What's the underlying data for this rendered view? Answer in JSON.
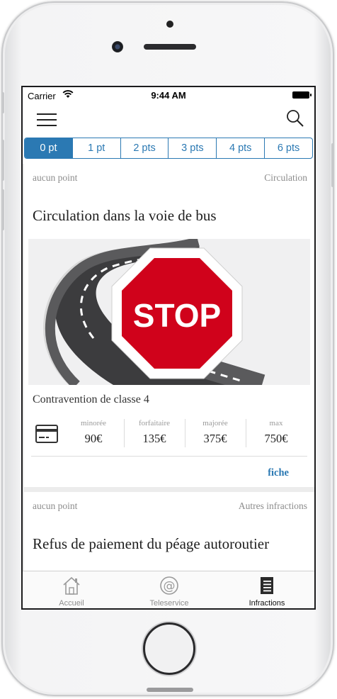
{
  "status_bar": {
    "carrier": "Carrier",
    "time": "9:44 AM"
  },
  "navbar": {
    "menu_icon": "hamburger-menu-icon",
    "search_icon": "search-icon"
  },
  "segments": [
    {
      "label": "0 pt",
      "selected": true
    },
    {
      "label": "1 pt",
      "selected": false
    },
    {
      "label": "2 pts",
      "selected": false
    },
    {
      "label": "3 pts",
      "selected": false
    },
    {
      "label": "4 pts",
      "selected": false
    },
    {
      "label": "6 pts",
      "selected": false
    }
  ],
  "cards": [
    {
      "points": "aucun point",
      "category": "Circulation",
      "title": "Circulation dans la voie de bus",
      "image": {
        "sign_text": "STOP",
        "icon": "stop-sign-road-illustration"
      },
      "classe": "Contravention de classe 4",
      "payment_icon": "credit-card-icon",
      "prices": [
        {
          "label": "minorée",
          "value": "90€"
        },
        {
          "label": "forfaitaire",
          "value": "135€"
        },
        {
          "label": "majorée",
          "value": "375€"
        },
        {
          "label": "max",
          "value": "750€"
        }
      ],
      "link": "fiche"
    },
    {
      "points": "aucun point",
      "category": "Autres infractions",
      "title": "Refus de paiement du péage autoroutier"
    }
  ],
  "tabbar": [
    {
      "label": "Accueil",
      "icon": "home-icon",
      "active": false
    },
    {
      "label": "Teleservice",
      "icon": "at-sign-icon",
      "active": false
    },
    {
      "label": "Infractions",
      "icon": "document-list-icon",
      "active": true
    }
  ],
  "colors": {
    "accent": "#2b79b3",
    "stop_red": "#d0021b"
  }
}
